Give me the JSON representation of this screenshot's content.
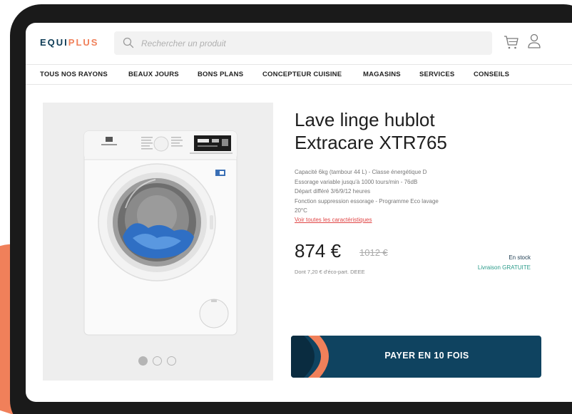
{
  "header": {
    "logo_part1": "EQUI",
    "logo_part2": "PLUS",
    "search_placeholder": "Rechercher un produit"
  },
  "nav": {
    "items": [
      "TOUS NOS RAYONS",
      "BEAUX JOURS",
      "BONS PLANS",
      "CONCEPTEUR CUISINE",
      "MAGASINS",
      "SERVICES",
      "CONSEILS"
    ]
  },
  "product": {
    "title_line1": "Lave linge hublot",
    "title_line2": "Extracare XTR765",
    "specs": [
      "Capacité 6kg (tambour 44 L) - Classe énergétique D",
      "Essorage variable jusqu'à 1000 tours/min - 76dB",
      "Départ différé 3/6/9/12 heures",
      "Fonction suppression essorage - Programme Eco lavage",
      "20°C"
    ],
    "specs_link": "Voir toutes les caractéristiques",
    "price": "874 €",
    "old_price": "1012 €",
    "eco_part": "Dont 7,20 € d'éco-part. DEEE",
    "stock": "En stock",
    "delivery": "Livraison GRATUITE",
    "pay_button": "PAYER EN 10 FOIS",
    "carousel_active_index": 0,
    "carousel_count": 3
  },
  "colors": {
    "brand_dark": "#0d3b55",
    "brand_accent": "#f0805a",
    "button_bg": "#0f4360",
    "link_red": "#e04545",
    "delivery_teal": "#2a9b8a"
  },
  "icons": {
    "search": "search-icon",
    "cart": "cart-icon",
    "user": "user-icon"
  }
}
